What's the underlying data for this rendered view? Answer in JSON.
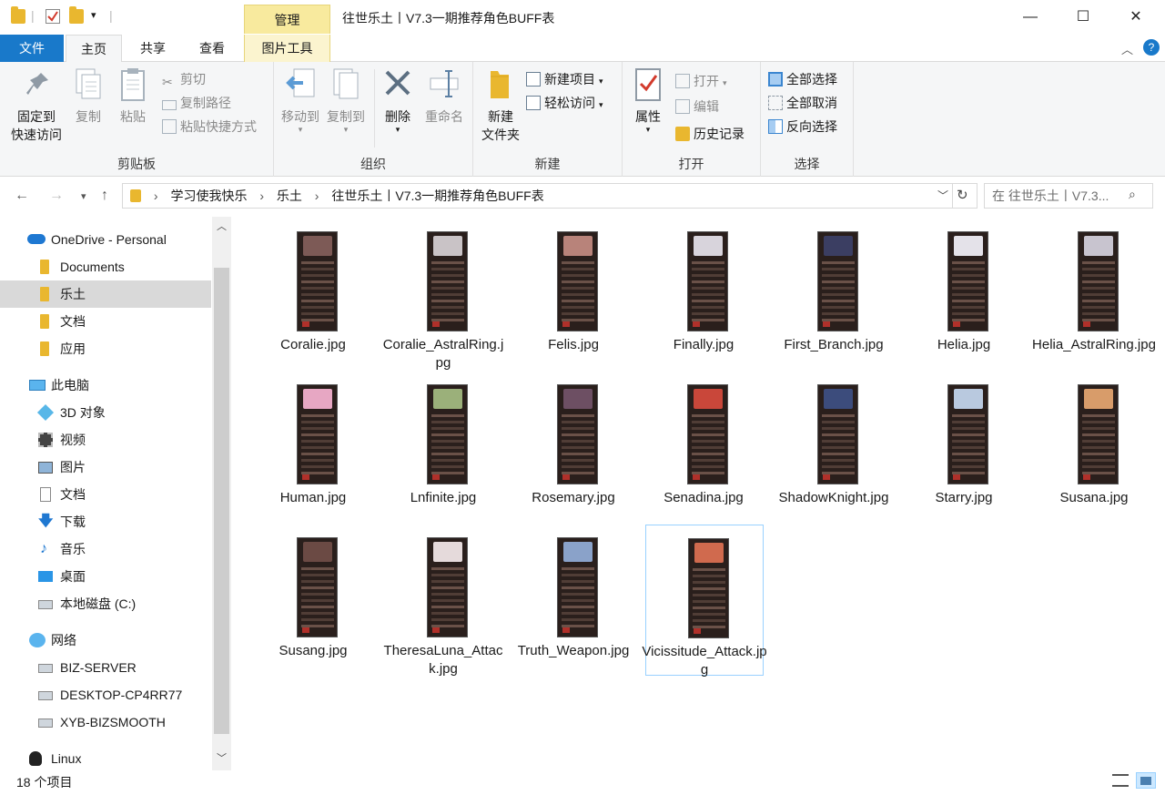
{
  "titlebar": {
    "ctx_tab": "管理",
    "title": "往世乐土丨V7.3一期推荐角色BUFF表",
    "minimize": "—",
    "maximize": "☐",
    "close": "✕"
  },
  "tabs": {
    "file": "文件",
    "home": "主页",
    "share": "共享",
    "view": "查看",
    "picture_tools": "图片工具"
  },
  "ribbon": {
    "clipboard": {
      "label": "剪贴板",
      "pin_line1": "固定到",
      "pin_line2": "快速访问",
      "copy": "复制",
      "paste": "粘贴",
      "cut": "剪切",
      "copy_path": "复制路径",
      "paste_shortcut": "粘贴快捷方式"
    },
    "organize": {
      "label": "组织",
      "move_to": "移动到",
      "copy_to": "复制到",
      "delete": "删除",
      "rename": "重命名"
    },
    "new": {
      "label": "新建",
      "new_folder_line1": "新建",
      "new_folder_line2": "文件夹",
      "new_item": "新建项目",
      "easy_access": "轻松访问"
    },
    "open": {
      "label": "打开",
      "properties": "属性",
      "open": "打开",
      "edit": "编辑",
      "history": "历史记录"
    },
    "select": {
      "label": "选择",
      "select_all": "全部选择",
      "select_none": "全部取消",
      "invert": "反向选择"
    }
  },
  "address": {
    "crumbs": [
      "学习使我快乐",
      "乐土",
      "往世乐土丨V7.3一期推荐角色BUFF表"
    ],
    "search_placeholder": "在 往世乐土丨V7.3..."
  },
  "navpane": {
    "onedrive": "OneDrive - Personal",
    "documents": "Documents",
    "letu": "乐土",
    "wendang": "文档",
    "yingyong": "应用",
    "thispc": "此电脑",
    "objects3d": "3D 对象",
    "videos": "视频",
    "pictures": "图片",
    "docs": "文档",
    "downloads": "下载",
    "music": "音乐",
    "desktop": "桌面",
    "localdisk": "本地磁盘 (C:)",
    "network": "网络",
    "server1": "BIZ-SERVER",
    "server2": "DESKTOP-CP4RR77",
    "server3": "XYB-BIZSMOOTH",
    "linux": "Linux"
  },
  "files": [
    {
      "name": "Coralie.jpg",
      "portrait": "#7d5a56"
    },
    {
      "name": "Coralie_AstralRing.jpg",
      "portrait": "#c9c3c6"
    },
    {
      "name": "Felis.jpg",
      "portrait": "#b8837a"
    },
    {
      "name": "Finally.jpg",
      "portrait": "#d8d4dc"
    },
    {
      "name": "First_Branch.jpg",
      "portrait": "#3b3e62"
    },
    {
      "name": "Helia.jpg",
      "portrait": "#e4e2e9"
    },
    {
      "name": "Helia_AstralRing.jpg",
      "portrait": "#c8c4cf"
    },
    {
      "name": "Human.jpg",
      "portrait": "#e7a7c3"
    },
    {
      "name": "Lnfinite.jpg",
      "portrait": "#9bb07a"
    },
    {
      "name": "Rosemary.jpg",
      "portrait": "#6d4f63"
    },
    {
      "name": "Senadina.jpg",
      "portrait": "#c9473a"
    },
    {
      "name": "ShadowKnight.jpg",
      "portrait": "#3c4c7c"
    },
    {
      "name": "Starry.jpg",
      "portrait": "#b9c9df"
    },
    {
      "name": "Susana.jpg",
      "portrait": "#d89c6a"
    },
    {
      "name": "Susang.jpg",
      "portrait": "#6b4a44"
    },
    {
      "name": "TheresaLuna_Attack.jpg",
      "portrait": "#e5dadb"
    },
    {
      "name": "Truth_Weapon.jpg",
      "portrait": "#8aa2c9"
    },
    {
      "name": "Vicissitude_Attack.jpg",
      "portrait": "#d06a4e"
    }
  ],
  "status": {
    "count": "18 个项目"
  },
  "colors": {
    "accent": "#1979ca",
    "selection_border": "#99d1ff",
    "folder": "#e9b72f"
  }
}
